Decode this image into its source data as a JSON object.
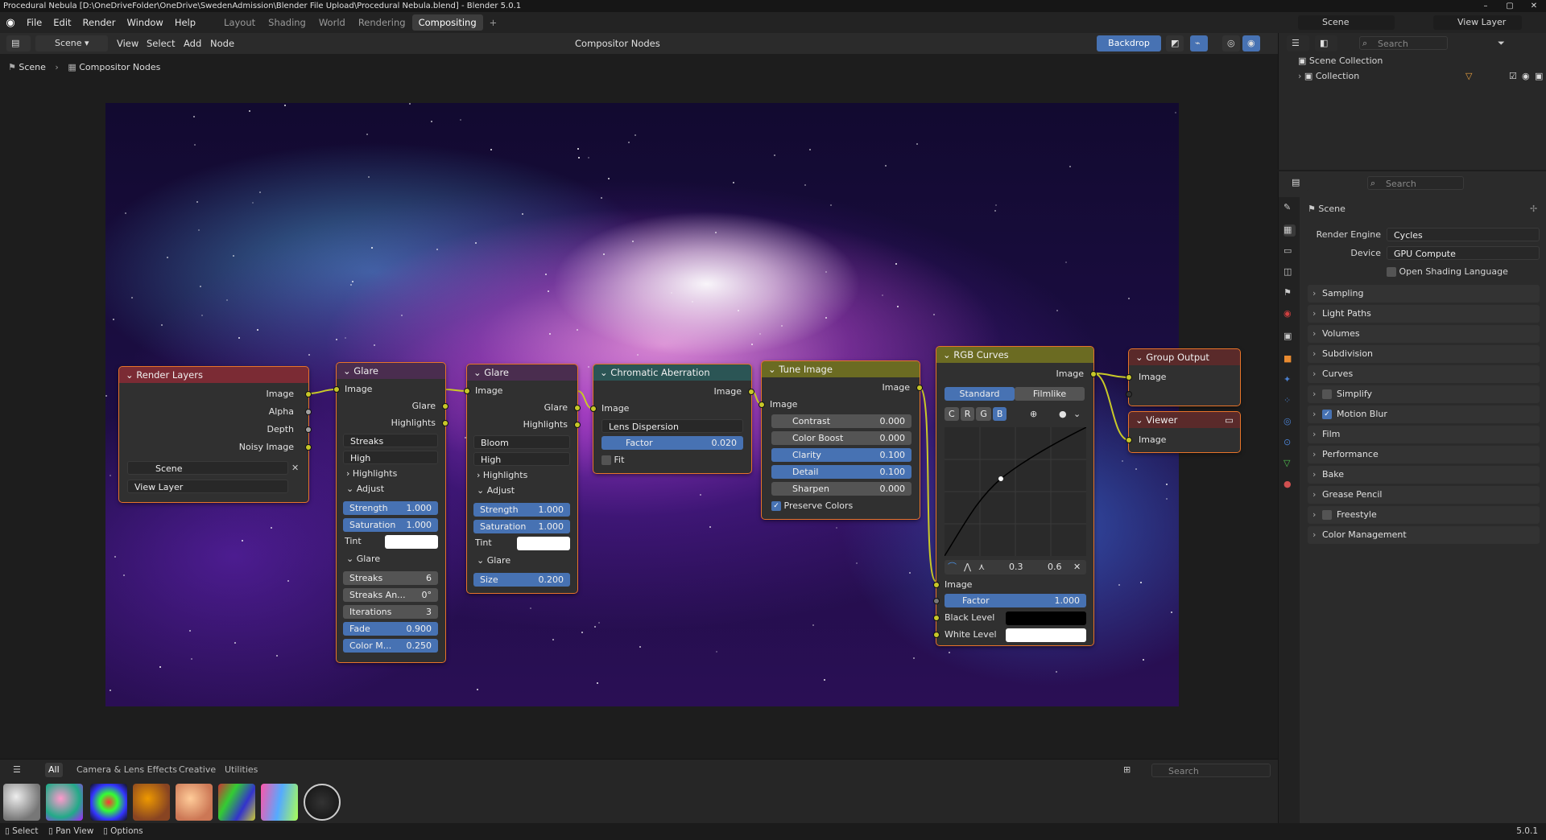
{
  "window": {
    "title": "Procedural Nebula [D:\\OneDriveFolder\\OneDrive\\SwedenAdmission\\Blender File Upload\\Procedural Nebula.blend] - Blender 5.0.1",
    "controls": [
      "–",
      "▢",
      "✕"
    ]
  },
  "menubar": {
    "menus": [
      "File",
      "Edit",
      "Render",
      "Window",
      "Help"
    ],
    "workspaces": [
      "Layout",
      "Shading",
      "World",
      "Rendering",
      "Compositing"
    ],
    "active_workspace": "Compositing",
    "add_workspace": "+",
    "scene": "Scene",
    "view_layer": "View Layer"
  },
  "editor_header": {
    "scene": "Scene",
    "menus": [
      "View",
      "Select",
      "Add",
      "Node"
    ],
    "node_tree": "Compositor Nodes",
    "backdrop": "Backdrop"
  },
  "breadcrumb": [
    "Scene",
    "Compositor Nodes"
  ],
  "nodes": {
    "render_layers": {
      "title": "Render Layers",
      "outputs": [
        "Image",
        "Alpha",
        "Depth",
        "Noisy Image"
      ],
      "scene": "Scene",
      "view_layer": "View Layer"
    },
    "glare1": {
      "title": "Glare",
      "in_image": "Image",
      "outputs": [
        "Glare",
        "Highlights"
      ],
      "type": "Streaks",
      "quality": "High",
      "highlights": "Highlights",
      "adjust": "Adjust",
      "strength_label": "Strength",
      "strength": "1.000",
      "saturation_label": "Saturation",
      "saturation": "1.000",
      "tint": "Tint",
      "glare_section": "Glare",
      "streaks_label": "Streaks",
      "streaks": "6",
      "angle_label": "Streaks An...",
      "angle": "0°",
      "iterations_label": "Iterations",
      "iterations": "3",
      "fade_label": "Fade",
      "fade": "0.900",
      "color_label": "Color M...",
      "color": "0.250"
    },
    "glare2": {
      "title": "Glare",
      "in_image": "Image",
      "outputs": [
        "Glare",
        "Highlights"
      ],
      "type": "Bloom",
      "quality": "High",
      "highlights": "Highlights",
      "adjust": "Adjust",
      "strength_label": "Strength",
      "strength": "1.000",
      "saturation_label": "Saturation",
      "saturation": "1.000",
      "tint": "Tint",
      "glare_section": "Glare",
      "size_label": "Size",
      "size": "0.200"
    },
    "chromatic": {
      "title": "Chromatic Aberration",
      "out_image": "Image",
      "in_image": "Image",
      "mode": "Lens Dispersion",
      "factor_label": "Factor",
      "factor": "0.020",
      "fit": "Fit"
    },
    "tune": {
      "title": "Tune Image",
      "out_image": "Image",
      "in_image": "Image",
      "contrast_label": "Contrast",
      "contrast": "0.000",
      "boost_label": "Color Boost",
      "boost": "0.000",
      "clarity_label": "Clarity",
      "clarity": "0.100",
      "detail_label": "Detail",
      "detail": "0.100",
      "sharpen_label": "Sharpen",
      "sharpen": "0.000",
      "preserve": "Preserve Colors"
    },
    "curves": {
      "title": "RGB Curves",
      "out_image": "Image",
      "mode_standard": "Standard",
      "mode_filmlike": "Filmlike",
      "channels": [
        "C",
        "R",
        "G",
        "B"
      ],
      "point_x": "0.3",
      "point_y": "0.6",
      "in_image": "Image",
      "factor_label": "Factor",
      "factor": "1.000",
      "black": "Black Level",
      "white": "White Level"
    },
    "group_output": {
      "title": "Group Output",
      "in_image": "Image"
    },
    "viewer": {
      "title": "Viewer",
      "in_image": "Image"
    }
  },
  "outliner": {
    "search_placeholder": "Search",
    "scene_collection": "Scene Collection",
    "collection": "Collection"
  },
  "properties": {
    "search_placeholder": "Search",
    "scene": "Scene",
    "render_engine_label": "Render Engine",
    "render_engine": "Cycles",
    "device_label": "Device",
    "device": "GPU Compute",
    "osl": "Open Shading Language",
    "panels": [
      "Sampling",
      "Light Paths",
      "Volumes",
      "Subdivision",
      "Curves",
      "Simplify",
      "Motion Blur",
      "Film",
      "Performance",
      "Bake",
      "Grease Pencil",
      "Freestyle",
      "Color Management"
    ]
  },
  "asset_shelf": {
    "tabs": [
      "All",
      "Camera & Lens Effects",
      "Creative",
      "Utilities"
    ],
    "active_tab": "All",
    "search_placeholder": "Search"
  },
  "statusbar": {
    "items": [
      "Select",
      "Pan View",
      "Options"
    ],
    "version": "5.0.1"
  }
}
